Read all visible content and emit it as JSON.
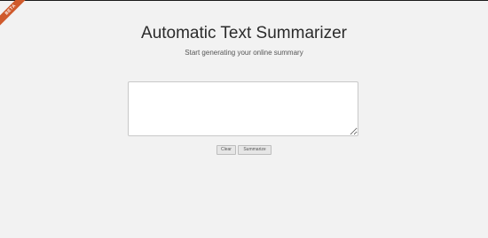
{
  "ribbon": {
    "label": "BETA",
    "color": "#cf5a2c"
  },
  "header": {
    "title": "Automatic Text Summarizer",
    "subtitle": "Start generating your online summary"
  },
  "input": {
    "value": "",
    "placeholder": ""
  },
  "actions": {
    "clear_label": "Clear",
    "summarize_label": "Summarize"
  }
}
